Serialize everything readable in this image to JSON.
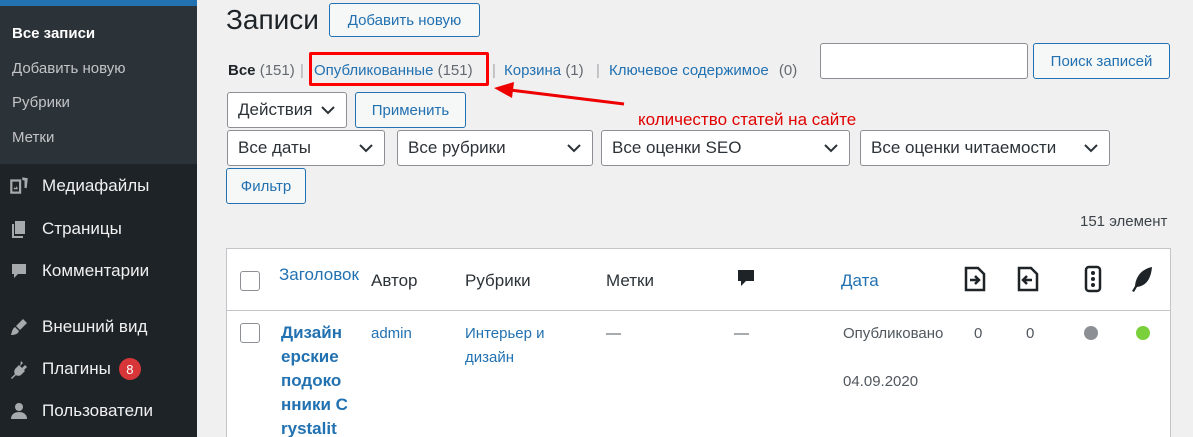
{
  "sidebar": {
    "submenu": [
      {
        "label": "Все записи",
        "active": true
      },
      {
        "label": "Добавить новую",
        "active": false
      },
      {
        "label": "Рубрики",
        "active": false
      },
      {
        "label": "Метки",
        "active": false
      }
    ],
    "menu": [
      {
        "label": "Медиафайлы",
        "icon": "media-icon"
      },
      {
        "label": "Страницы",
        "icon": "pages-icon"
      },
      {
        "label": "Комментарии",
        "icon": "comments-icon"
      },
      {
        "label": "Внешний вид",
        "icon": "appearance-icon"
      },
      {
        "label": "Плагины",
        "icon": "plugins-icon",
        "badge": "8"
      },
      {
        "label": "Пользователи",
        "icon": "users-icon"
      }
    ]
  },
  "page": {
    "title": "Записи",
    "add_new": "Добавить новую"
  },
  "views": [
    {
      "label": "Все",
      "count": "(151)"
    },
    {
      "label": "Опубликованные",
      "count": "(151)"
    },
    {
      "label": "Корзина",
      "count": "(1)"
    },
    {
      "label": "Ключевое содержимое",
      "count": "(0)"
    }
  ],
  "search": {
    "value": "",
    "button": "Поиск записей"
  },
  "bulk": {
    "select": "Действия",
    "apply": "Применить"
  },
  "filters": {
    "dates": "Все даты",
    "categories": "Все рубрики",
    "seo": "Все оценки SEO",
    "readability": "Все оценки читаемости",
    "button": "Фильтр"
  },
  "annotation": "количество статей на сайте",
  "items_count": "151 элемент",
  "table": {
    "headers": {
      "title": "Заголовок",
      "author": "Автор",
      "categories": "Рубрики",
      "tags": "Метки",
      "date": "Дата"
    },
    "row": {
      "title": "Дизайнерские подоконники Crystalit",
      "author": "admin",
      "categories": "Интерьер и дизайн",
      "tags": "—",
      "comments": "—",
      "status": "Опубликовано",
      "date": "04.09.2020",
      "links_out": "0",
      "links_in": "0"
    }
  },
  "colors": {
    "accent": "#2271b1",
    "sidebar": "#1d2327",
    "highlight": "#ff0000",
    "seo_dot": "#8c8f94",
    "readability_dot": "#7ad03a"
  }
}
